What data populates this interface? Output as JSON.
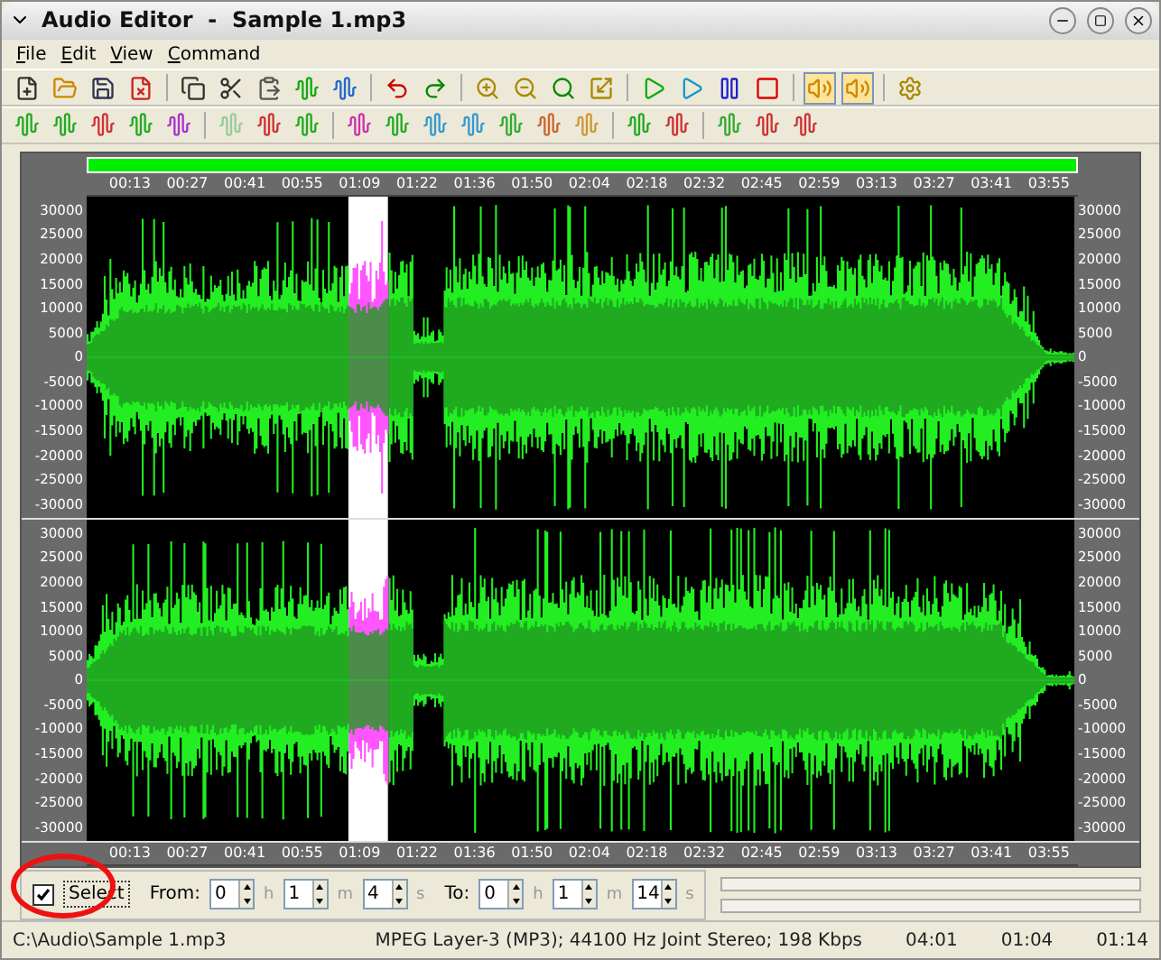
{
  "window": {
    "title": "Audio Editor  -  Sample 1.mp3"
  },
  "menu": [
    "File",
    "Edit",
    "View",
    "Command"
  ],
  "toolbar": {
    "speaker_buttons": [
      {
        "pressed": true
      },
      {
        "pressed": true
      }
    ]
  },
  "time_ruler_top": [
    "00:13",
    "00:27",
    "00:41",
    "00:55",
    "01:09",
    "01:22",
    "01:36",
    "01:50",
    "02:04",
    "02:18",
    "02:32",
    "02:45",
    "02:59",
    "03:13",
    "03:27",
    "03:41",
    "03:55"
  ],
  "channels": [
    {
      "left_axis": [
        "30000",
        "25000",
        "20000",
        "15000",
        "10000",
        "5000",
        "0",
        "-5000",
        "-10000",
        "-15000",
        "-20000",
        "-25000",
        "-30000"
      ],
      "right_axis": [
        "30000",
        "25000",
        "20000",
        "15000",
        "10000",
        "5000",
        "0",
        "-5000",
        "-10000",
        "-15000",
        "-20000",
        "-25000",
        "-30000"
      ]
    },
    {
      "left_axis": [
        "30000",
        "25000",
        "20000",
        "15000",
        "10000",
        "5000",
        "0",
        "-5000",
        "-10000",
        "-15000",
        "-20000",
        "-25000",
        "-30000"
      ],
      "right_axis": [
        "30000",
        "25000",
        "20000",
        "15000",
        "10000",
        "5000",
        "0",
        "-5000",
        "-10000",
        "-15000",
        "-20000",
        "-25000",
        "-30000"
      ]
    }
  ],
  "time_ruler_bottom": [
    "00:13",
    "00:27",
    "00:41",
    "00:55",
    "01:09",
    "01:22",
    "01:36",
    "01:50",
    "02:04",
    "02:18",
    "02:32",
    "02:45",
    "02:59",
    "03:13",
    "03:27",
    "03:41",
    "03:55"
  ],
  "selection": {
    "checked": true,
    "label": "Select",
    "from_label": "From:",
    "from": [
      {
        "value": "0",
        "unit": "h"
      },
      {
        "value": "1",
        "unit": "m"
      },
      {
        "value": "4",
        "unit": "s"
      }
    ],
    "to_label": "To:",
    "to": [
      {
        "value": "0",
        "unit": "h"
      },
      {
        "value": "1",
        "unit": "m"
      },
      {
        "value": "14",
        "unit": "s"
      }
    ]
  },
  "status_bar": {
    "path": "C:\\Audio\\Sample 1.mp3",
    "format": "MPEG Layer-3 (MP3); 44100 Hz Joint Stereo; 198 Kbps",
    "times": [
      "04:01",
      "01:04",
      "01:14"
    ]
  }
}
